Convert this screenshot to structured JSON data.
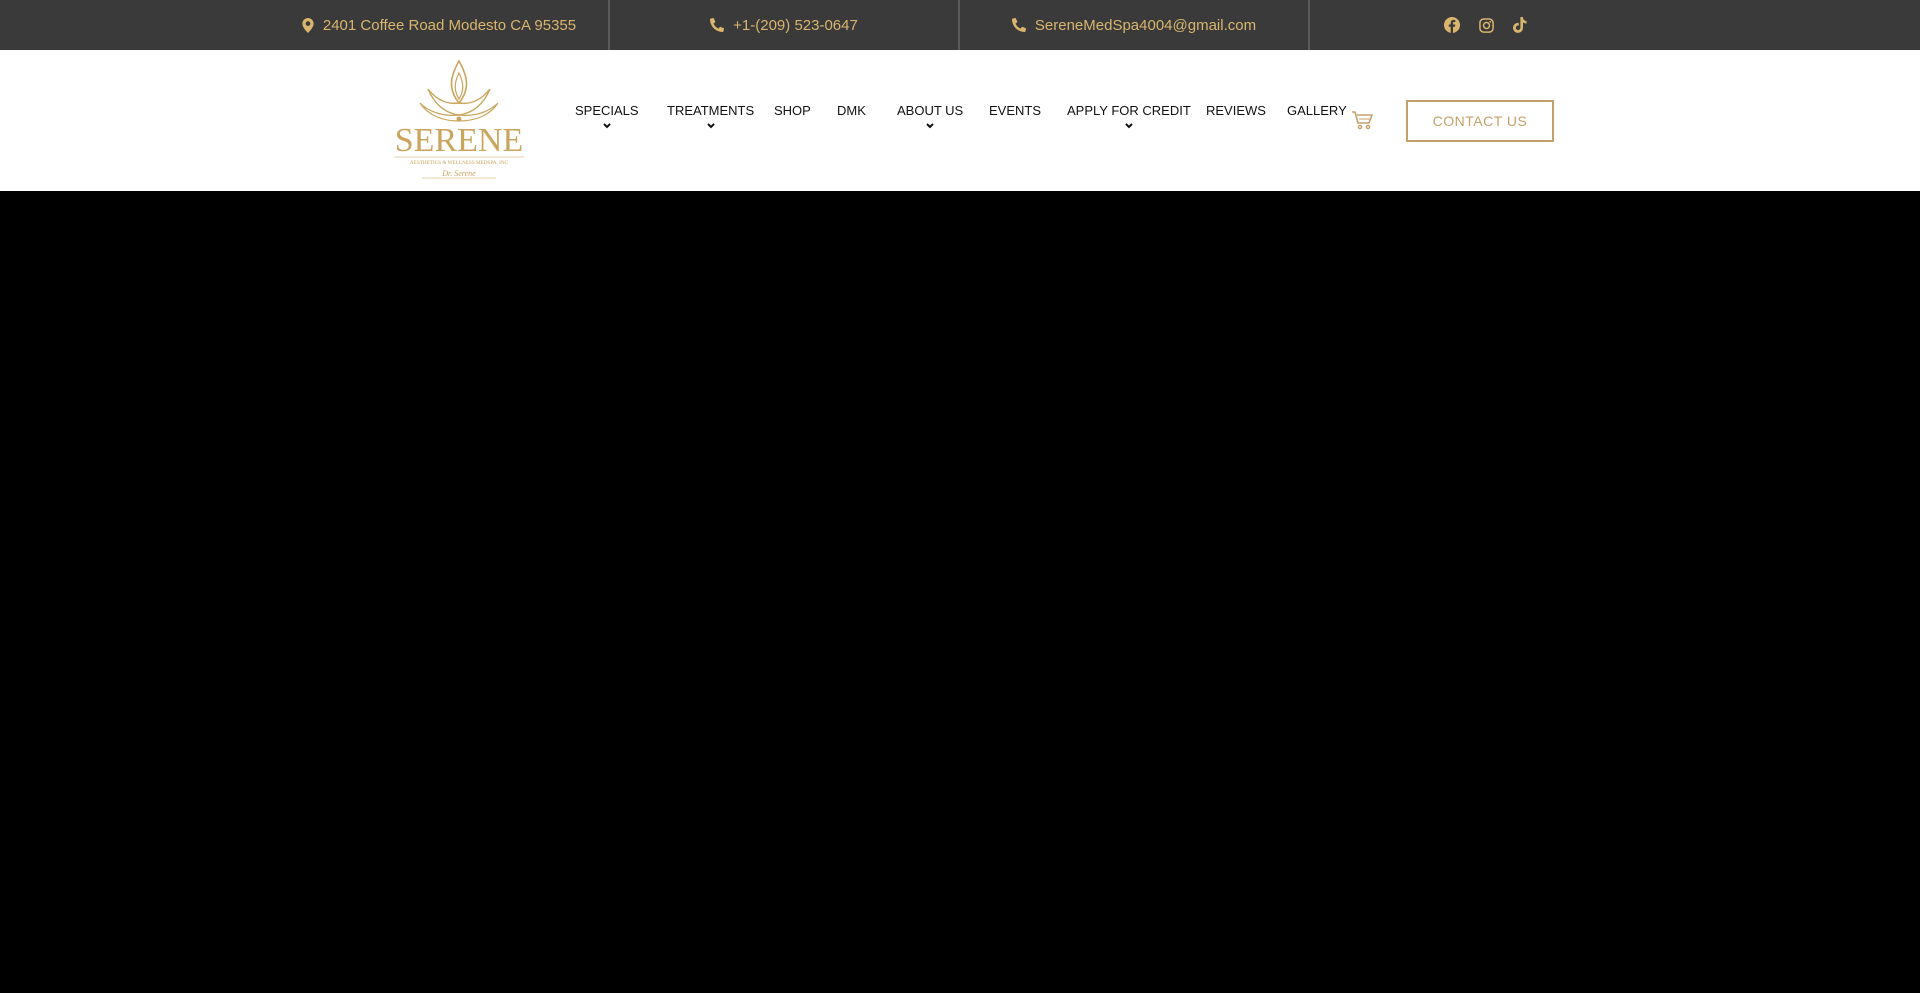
{
  "topbar": {
    "address": "2401 Coffee Road Modesto CA 95355",
    "phone": "+1-(209) 523-0647",
    "email": "SereneMedSpa4004@gmail.com",
    "social": [
      "facebook-icon",
      "instagram-icon",
      "tiktok-icon"
    ]
  },
  "logo": {
    "brand": "SERENE",
    "tagline": "AESTHETICS & WELLNESS MEDSPA, INC",
    "signature": "Dr. Serene"
  },
  "nav": {
    "items": [
      {
        "label": "SPECIALS",
        "dropdown": true
      },
      {
        "label": "TREATMENTS",
        "dropdown": true
      },
      {
        "label": "SHOP",
        "dropdown": false
      },
      {
        "label": "DMK",
        "dropdown": false
      },
      {
        "label": "ABOUT US",
        "dropdown": true
      },
      {
        "label": "EVENTS",
        "dropdown": false
      },
      {
        "label": "APPLY FOR CREDIT",
        "dropdown": true
      },
      {
        "label": "REVIEWS",
        "dropdown": false
      },
      {
        "label": "GALLERY",
        "dropdown": false
      }
    ],
    "cart_icon": "cart-icon",
    "contact_label": "CONTACT US"
  },
  "colors": {
    "topbar_bg": "#3a3a3a",
    "accent_gold": "#d9b56e",
    "button_gold": "#c5a16a",
    "hero_bg": "#000000"
  }
}
